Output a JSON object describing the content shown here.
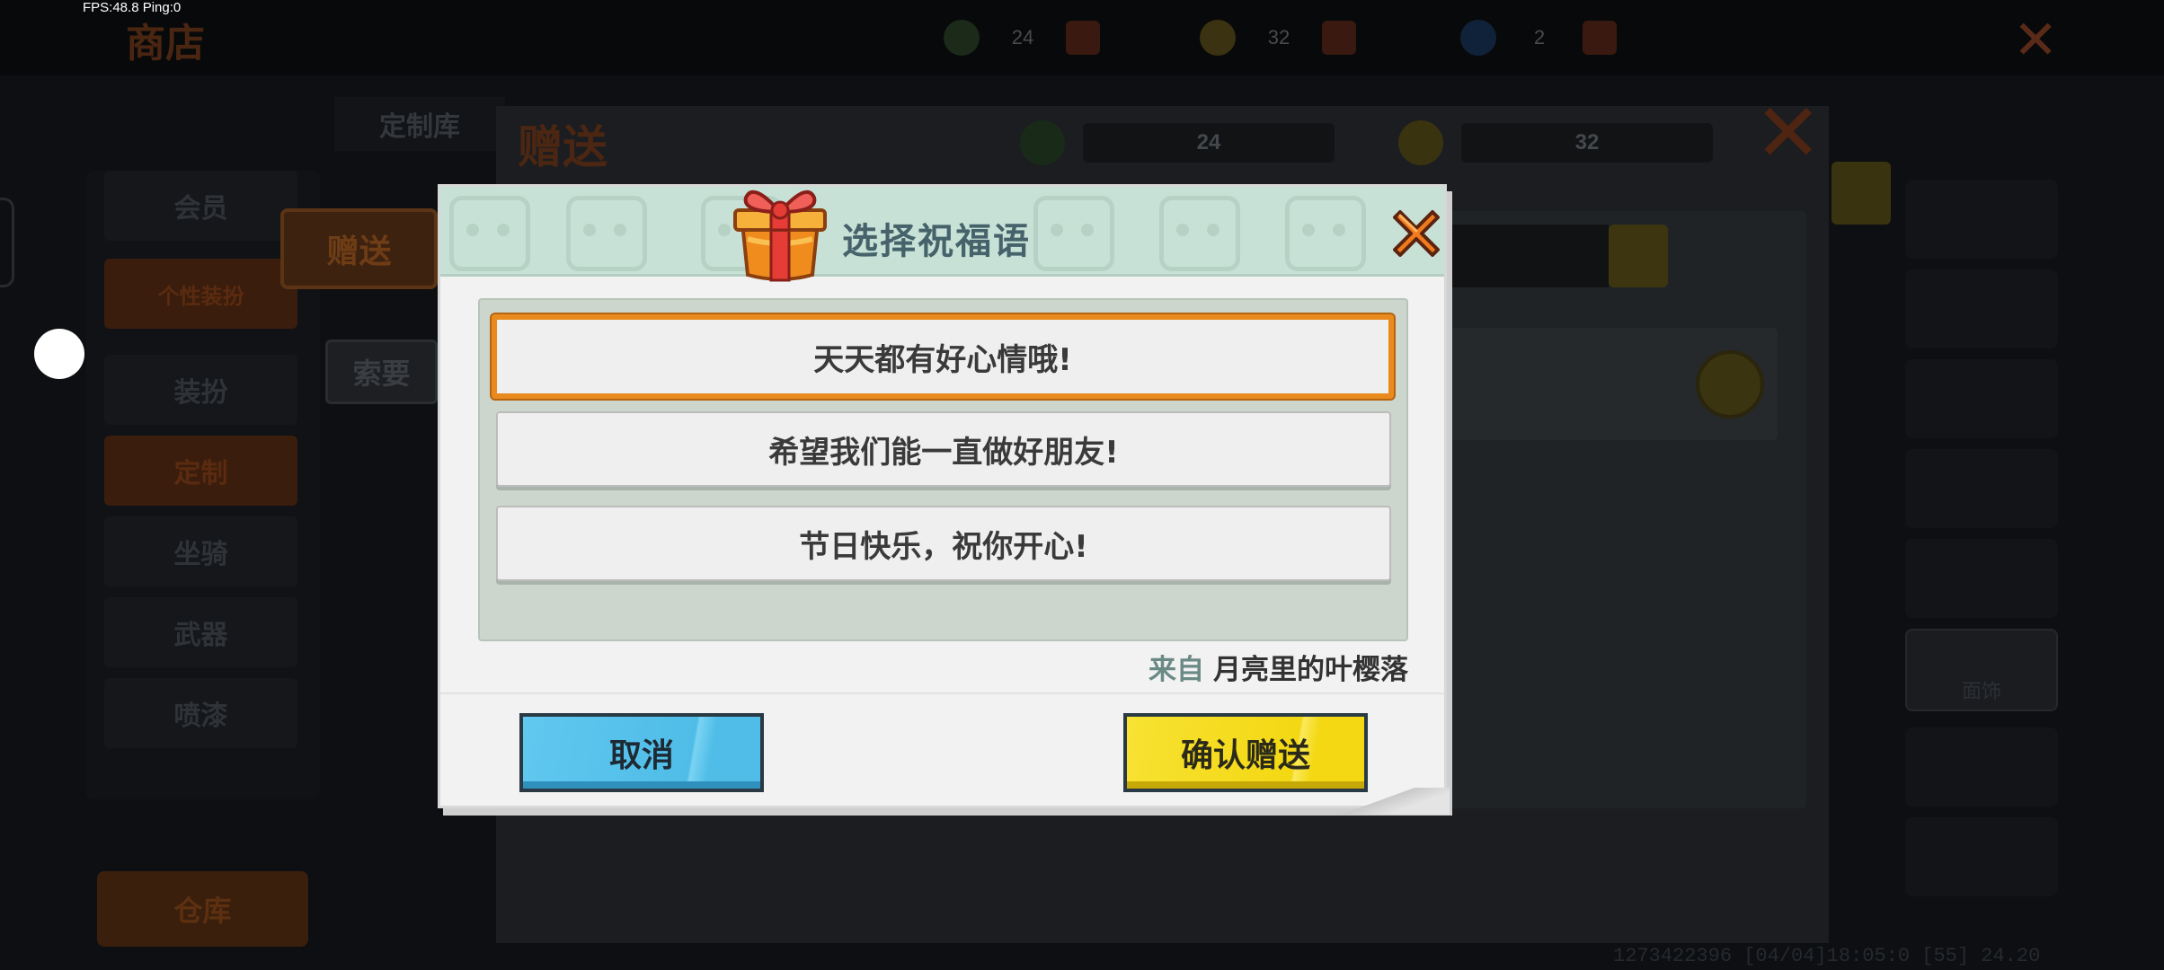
{
  "status": {
    "fps": "FPS:48.8  Ping:0"
  },
  "background": {
    "top_title": "商店",
    "top_resources": [
      "24",
      "32",
      "2"
    ],
    "nav_tab": "定制库",
    "sidebar_items": [
      "会员",
      "个性装扮",
      "装扮",
      "定制",
      "坐骑",
      "武器",
      "喷漆"
    ],
    "bottom_button": "仓库",
    "tab_give": "赠送",
    "tab_request": "索要",
    "give_title": "赠送",
    "give_resources": [
      "24",
      "32"
    ],
    "right_item_label": "面饰",
    "id_text": "1273422396  [04/04]18:05:0 [55] 24.20"
  },
  "dialog": {
    "title": "选择祝福语",
    "options": [
      {
        "text": "天天都有好心情哦!",
        "selected": true
      },
      {
        "text": "希望我们能一直做好朋友!",
        "selected": false
      },
      {
        "text": "节日快乐，祝你开心!",
        "selected": false
      }
    ],
    "from_label": "来自",
    "from_name": "月亮里的叶樱落",
    "cancel_label": "取消",
    "confirm_label": "确认赠送"
  },
  "colors": {
    "selected_border": "#e88a1e",
    "cancel_button": "#4fbde8",
    "confirm_button": "#f3d813",
    "close_x": "#f07a1e"
  },
  "icons": [
    "gift-icon",
    "close-icon",
    "search-icon",
    "green-gem-icon",
    "gold-coin-icon"
  ]
}
